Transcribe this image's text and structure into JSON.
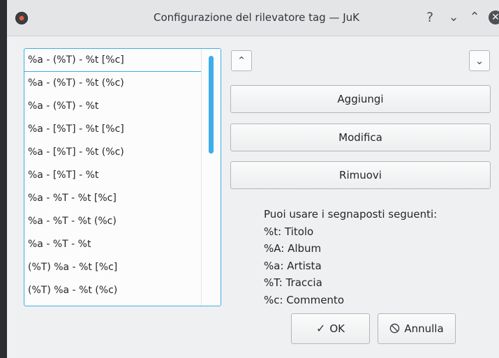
{
  "window": {
    "title": "Configurazione del rilevatore tag — JuK",
    "icons": {
      "app": "juk-app-icon",
      "help": "help-icon",
      "minimize": "minimize-icon",
      "maximize": "maximize-icon",
      "close": "close-icon"
    }
  },
  "titlebar_glyphs": {
    "help": "?",
    "minimize": "⌄",
    "maximize": "⌃",
    "close": "✕"
  },
  "list": {
    "items": [
      "%a - (%T) - %t [%c]",
      "%a - (%T) - %t (%c)",
      "%a - (%T) - %t",
      "%a - [%T] - %t [%c]",
      "%a - [%T] - %t (%c)",
      "%a - [%T] - %t",
      "%a - %T - %t [%c]",
      "%a - %T - %t (%c)",
      "%a - %T - %t",
      "(%T) %a - %t [%c]",
      "(%T) %a - %t (%c)"
    ],
    "selected_index": 0
  },
  "buttons": {
    "move_up_glyph": "⌃",
    "move_down_glyph": "⌄",
    "add": "Aggiungi",
    "edit": "Modifica",
    "remove": "Rimuovi"
  },
  "placeholders": {
    "intro": "Puoi usare i segnaposti seguenti:",
    "lines": [
      "%t: Titolo",
      "%A: Album",
      "%a: Artista",
      "%T: Traccia",
      "%c: Commento"
    ]
  },
  "dialog": {
    "ok_label": "OK",
    "ok_glyph": "✓",
    "cancel_label": "Annulla",
    "cancel_glyph": "⃠"
  },
  "colors": {
    "accent": "#3daee9",
    "window_bg": "#eff0f1",
    "titlebar_bg": "#e3e5e7"
  }
}
